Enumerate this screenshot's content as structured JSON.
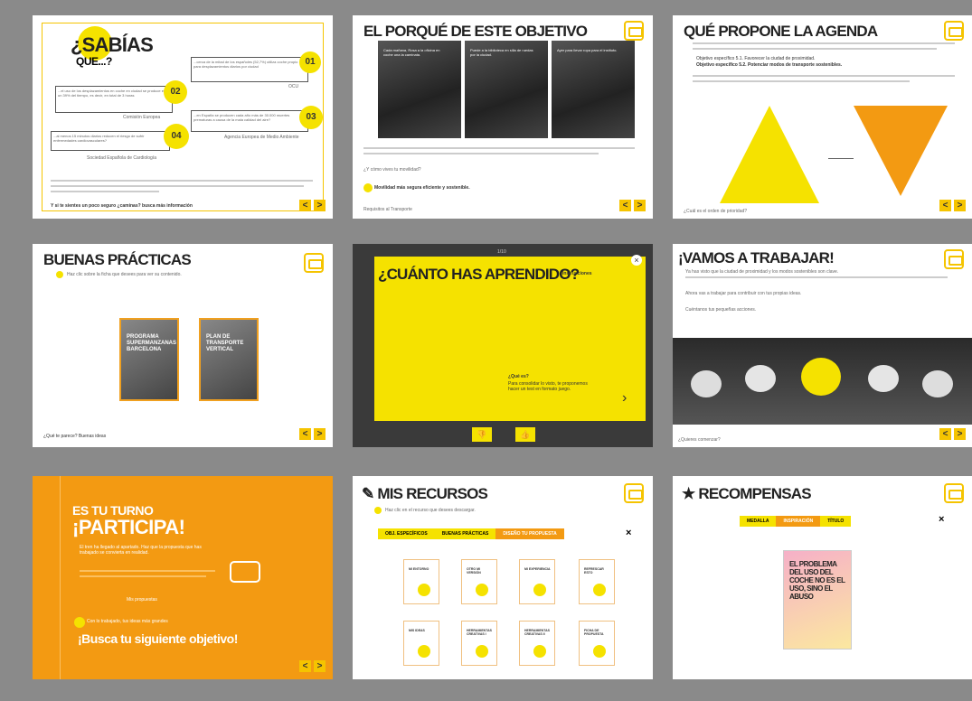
{
  "slides": {
    "s1": {
      "title_a": "¿SABÍAS",
      "title_b": "QUE...?",
      "n1": "01",
      "n2": "02",
      "n3": "03",
      "n4": "04",
      "b1": "...cerca de la mitad de los españoles (52,7%) utiliza coche propio para desplazamientos diarios por ciudad",
      "b1_src": "OCU",
      "b2": "...el uso de los desplazamientos en coche en ciudad se produce en un 39% del tiempo, es decir, en total de 3 horas",
      "b2_src": "Comisión Europea",
      "b3": "...en España se producen cada año más de 30.000 muertes prematuras a causa de la mala calidad del aire?",
      "b3_src": "Agencia Europea de Medio Ambiente",
      "b4": "...al menos 15 minutos diarios reducen el riesgo de sufrir enfermedades cardiovasculares?",
      "b4_src": "Sociedad Española de Cardiología",
      "footer": "Y si te sientes un poco seguro ¿caminas? busca más información"
    },
    "s2": {
      "title": "EL PORQUÉ DE ESTE OBJETIVO",
      "c1": "Cada mañana, Rosa a la oficina en coche una la caminata.",
      "c2": "Puede a la biblioteca en silla de ruedas por la ciudad.",
      "c3": "Ayer para llevar ropa para el instituto.",
      "q": "¿Y cómo vives tu movilidad?",
      "hint": "Movilidad más segura eficiente y sostenible.",
      "footer": "Requisitos al Transporte"
    },
    "s3": {
      "title": "QUÉ PROPONE LA AGENDA",
      "obj1": "Objetivo específico 5.1. Favorecer la ciudad de proximidad.",
      "obj2": "Objetivo específico 5.2. Potenciar modos de transporte sostenibles.",
      "footer": "¿Cuál es el orden de prioridad?"
    },
    "s4": {
      "title": "BUENAS PRÁCTICAS",
      "hint": "Haz clic sobre la ficha que desees para ver su contenido.",
      "card1": "PROGRAMA SUPERMANZANAS BARCELONA",
      "card2": "PLAN DE TRANSPORTE VERTICAL",
      "footer": "¿Qué te parece? Buenas ideas"
    },
    "s5": {
      "title": "¿CUÁNTO HAS APRENDIDO?",
      "instr": "Instrucciones",
      "q": "¿Qué es?",
      "txt": "Para consolidar lo visto, te proponemos hacer un test en formato juego.",
      "top": "1/10"
    },
    "s6": {
      "title": "¡VAMOS A TRABAJAR!",
      "p1": "Ya has visto que la ciudad de proximidad y los modos sostenibles son clave.",
      "p2": "Ahora vas a trabajar para contribuir con tus propias ideas.",
      "p3": "Cuéntanos tus pequeñas acciones.",
      "footer": "¿Quieres comenzar?"
    },
    "s7": {
      "title_a": "ES TU TURNO",
      "title_b": "¡PARTICIPA!",
      "p": "El tren ha llegado al apartado. Haz que la propuesta que has trabajado se convierta en realidad.",
      "link": "Mis propuestas",
      "note": "Con lo trabajado, tus ideas más grandes",
      "cta": "¡Busca tu siguiente objetivo!"
    },
    "s8": {
      "title": "MIS RECURSOS",
      "hint": "Haz clic en el recurso que desees descargar.",
      "tabs": [
        "OBJ. ESPECÍFICOS",
        "BUENAS PRÁCTICAS",
        "DISEÑO TU PROPUESTA"
      ],
      "res": [
        "MI ENTORNO",
        "OTRO MI VERSIÓN",
        "MI EXPERIENCIA",
        "REFRESCAR ESTO",
        "MIS IDEAS",
        "HERRAMIENTAS CREATIVAS I",
        "HERRAMIENTAS CREATIVAS II",
        "FICHA DE PROPUESTA"
      ]
    },
    "s9": {
      "title": "RECOMPENSAS",
      "tabs": [
        "MEDALLA",
        "INSPIRACIÓN",
        "TÍTULO"
      ],
      "poster": "EL PROBLEMA DEL USO DEL COCHE NO ES EL USO, SINO EL ABUSO"
    }
  },
  "colors": {
    "yellow": "#f5e200",
    "orange": "#f39a12",
    "dark": "#3a3a3a"
  }
}
